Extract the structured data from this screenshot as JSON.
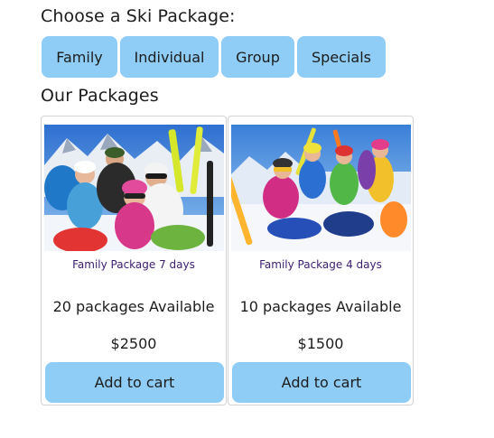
{
  "headings": {
    "choose": "Choose a Ski Package:",
    "packages": "Our Packages"
  },
  "tabs": [
    {
      "label": "Family"
    },
    {
      "label": "Individual"
    },
    {
      "label": "Group"
    },
    {
      "label": "Specials"
    }
  ],
  "colors": {
    "button_bg": "#8fcdf6",
    "package_name": "#3b1d6e"
  },
  "packages": [
    {
      "image": "ski-family-photo",
      "name": "Family Package 7 days",
      "availability": "20 packages Available",
      "price": "$2500",
      "button": "Add to cart"
    },
    {
      "image": "ski-group-photo",
      "name": "Family Package 4 days",
      "availability": "10 packages Available",
      "price": "$1500",
      "button": "Add to cart"
    }
  ]
}
